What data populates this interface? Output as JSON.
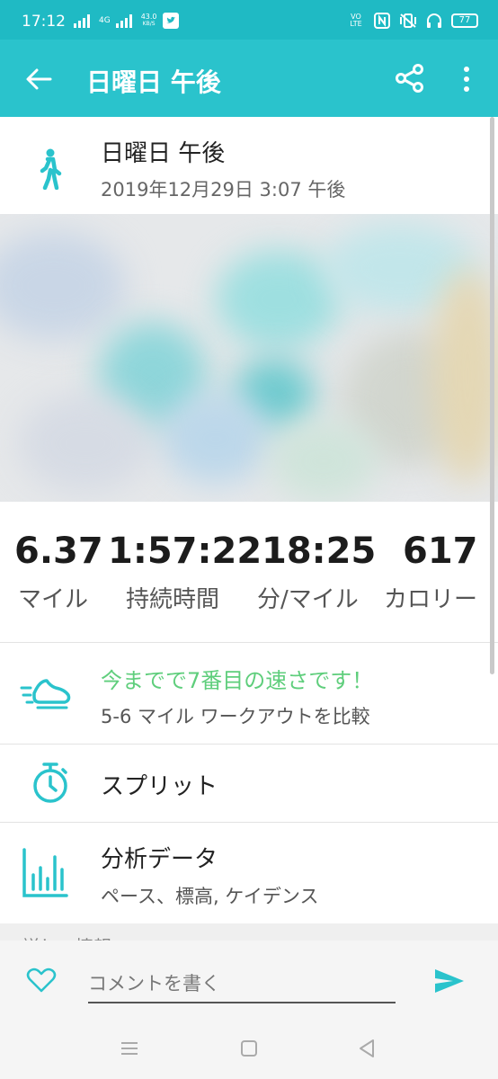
{
  "status_bar": {
    "time": "17:12",
    "network": "4G",
    "speed_value": "43.0",
    "speed_unit": "KB/S",
    "volte": "VO LTE",
    "battery": "77"
  },
  "app_bar": {
    "title": "日曜日 午後",
    "back_icon": "arrow-left-icon",
    "share_icon": "share-icon",
    "more_icon": "more-vert-icon"
  },
  "activity": {
    "title": "日曜日 午後",
    "datetime": "2019年12月29日 3:07 午後",
    "icon": "walking-person-icon"
  },
  "stats": [
    {
      "value": "6.37",
      "label": "マイル"
    },
    {
      "value": "1:57:22",
      "label": "持続時間"
    },
    {
      "value": "18:25",
      "label": "分/マイル"
    },
    {
      "value": "617",
      "label": "カロリー"
    }
  ],
  "rows": {
    "compare": {
      "title": "今までで7番目の速さです！",
      "subtitle": "5-6 マイル ワークアウトを比較",
      "icon": "running-shoe-icon"
    },
    "splits": {
      "title": "スプリット",
      "icon": "stopwatch-icon"
    },
    "analysis": {
      "title": "分析データ",
      "subtitle": "ペース、標高, ケイデンス",
      "icon": "bar-chart-icon"
    }
  },
  "details_peek": "詳しい情報",
  "comment": {
    "placeholder": "コメントを書く",
    "like_icon": "heart-icon",
    "send_icon": "send-icon"
  },
  "colors": {
    "accent": "#2ac3cc",
    "status_bar": "#1fbac4",
    "highlight_green": "#5fce7c"
  }
}
